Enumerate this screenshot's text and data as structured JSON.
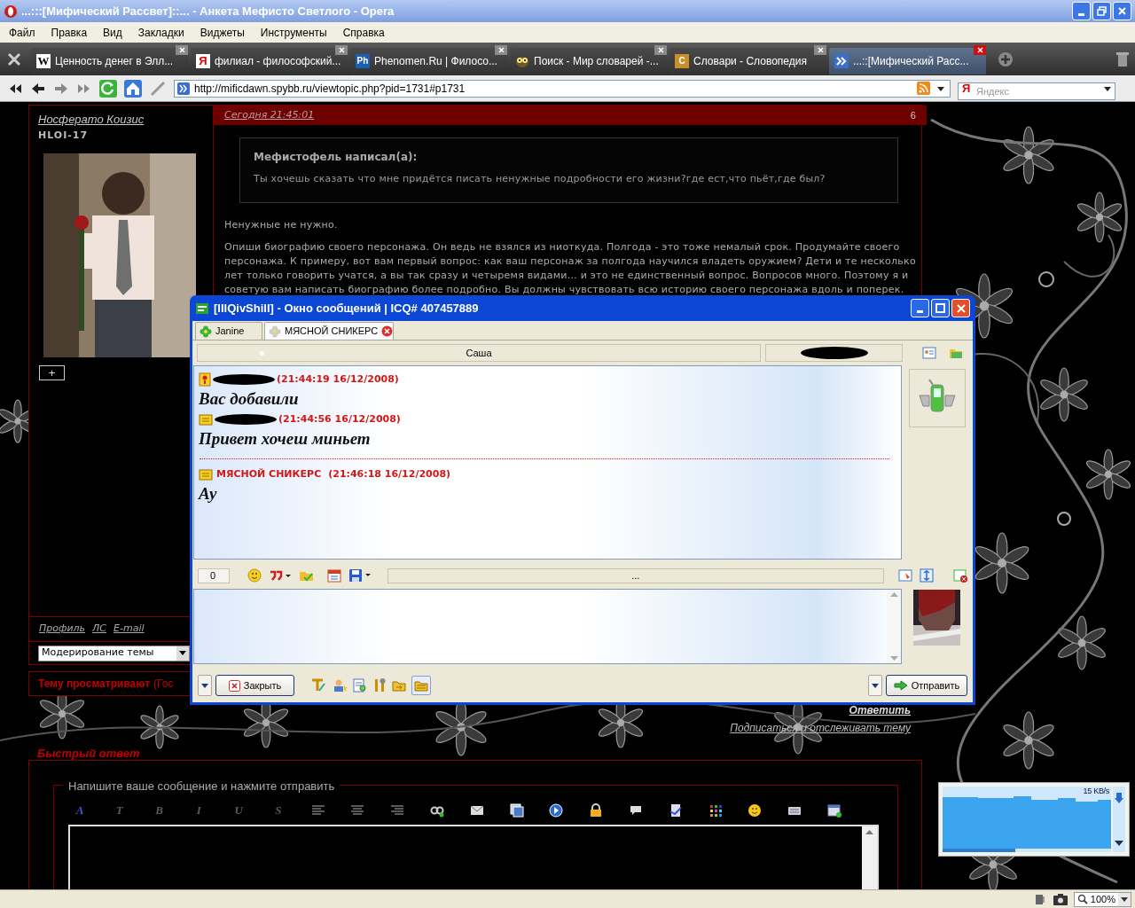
{
  "window": {
    "title": "...:::[Мифический Рассвет]::... - Анкета Мефисто Светлого - Opera"
  },
  "menu": [
    "Файл",
    "Правка",
    "Вид",
    "Закладки",
    "Виджеты",
    "Инструменты",
    "Справка"
  ],
  "tabs": [
    {
      "label": "Ценность денег в Элл...",
      "kind": "plain",
      "icon_text": "W",
      "selected": false
    },
    {
      "label": "филиал - философский...",
      "kind": "red",
      "icon_text": "Я",
      "selected": false
    },
    {
      "label": "Phenomen.Ru | Филосо...",
      "kind": "filled",
      "icon_text": "Ph",
      "color": "#1a5fb4",
      "selected": false
    },
    {
      "label": "Поиск - Мир словарей -...",
      "kind": "owl",
      "selected": false
    },
    {
      "label": "Словари - Словопедия",
      "kind": "filled",
      "icon_text": "C",
      "color": "#c8902a",
      "selected": false
    },
    {
      "label": "...::[Мифический Расс...",
      "kind": "arrows",
      "selected": true
    }
  ],
  "address_bar": {
    "url": "http://mificdawn.spybb.ru/viewtopic.php?pid=1731#p1731",
    "search_mark": "Я",
    "search_placeholder": "Яндекс"
  },
  "forum": {
    "author": {
      "name": "Носферато Коизис",
      "rank": "HLOI-17",
      "expand_button": "+",
      "links": [
        "Профиль",
        "ЛС",
        "E-mail"
      ]
    },
    "post": {
      "date": "Сегодня 21:45:01",
      "number": "6",
      "quote": {
        "author": "Мефистофель написал(а):",
        "text": "Ты хочешь сказать что мне придётся писать ненужные подробности его жизни?где ест,что пьёт,где был?"
      },
      "paragraphs": [
        [
          "Ненужные не нужно."
        ],
        [
          "Опиши биографию своего персонажа. Он ведь не взялся из ниоткуда. Полгода - это тоже немалый срок. Продумайте своего",
          "персонажа. К примеру, вот вам первый вопрос: как ваш персонаж за полгода научился владеть оружием? Дети и те несколько",
          "лет только говорить учатся, а вы так сразу и четыремя видами... и это не единственный вопрос. Вопросов много. Поэтому я и",
          "советую вам написать биографию более подробно. Вы должны чувствовать всю историю своего персонажа вдоль и поперек."
        ]
      ]
    },
    "moderation_select": "Модерирование темы",
    "viewers": {
      "label": "Тему просматривают",
      "rest": "(Гос"
    },
    "actions": [
      "Ответить",
      "Подписаться и отслеживать тему"
    ],
    "quick_reply": {
      "title": "Быстрый ответ",
      "legend": "Напишите ваше сообщение и нажмите отправить",
      "format_buttons": [
        {
          "text": "A",
          "color": "#3a5fd0"
        },
        {
          "text": "T",
          "color": "#5a5a5a"
        },
        {
          "text": "B",
          "color": "#5a5a5a"
        },
        {
          "text": "I",
          "color": "#5a5a5a"
        },
        {
          "text": "U",
          "color": "#5a5a5a"
        },
        {
          "text": "S",
          "color": "#5a5a5a"
        }
      ]
    }
  },
  "icq": {
    "title": "[IllQivShill] - Окно сообщений | ICQ# 407457889",
    "tabs": [
      {
        "label": "Janine",
        "selected": false
      },
      {
        "label": "МЯСНОЙ СНИКЕРС",
        "selected": true
      }
    ],
    "contact": {
      "name": "Саша"
    },
    "messages": [
      {
        "kind": "system",
        "sender_redacted": true,
        "time": "(21:44:19 16/12/2008)",
        "text": "Вас добавили",
        "separator_before": false
      },
      {
        "kind": "message",
        "sender_redacted": true,
        "time": "(21:44:56 16/12/2008)",
        "text": "Привет хочеш миньет",
        "separator_before": false
      },
      {
        "kind": "message",
        "sender_redacted": false,
        "sender": "МЯСНОЙ СНИКЕРС",
        "time": "(21:46:18 16/12/2008)",
        "text": "Ау",
        "separator_before": true
      }
    ],
    "char_count": "0",
    "status_text": "...",
    "close_button": "Закрыть",
    "send_button": "Отправить"
  },
  "traffic_widget": {
    "rate": "15 KB/s"
  },
  "status_bar": {
    "zoom": "100%"
  }
}
